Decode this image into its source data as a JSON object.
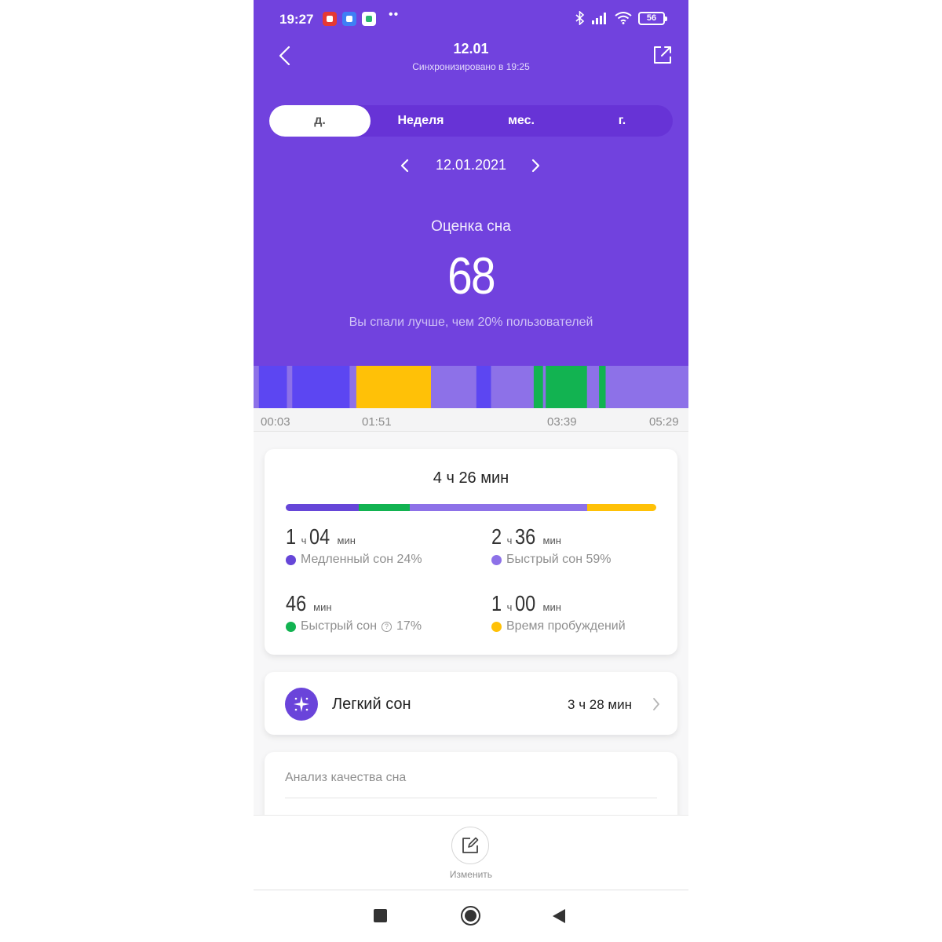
{
  "status_bar": {
    "time": "19:27",
    "notifications": [
      {
        "icon": "youtube-music-icon",
        "color": "#e53935"
      },
      {
        "icon": "message-icon",
        "color": "#3f7ff5"
      },
      {
        "icon": "mi-fit-icon",
        "color": "#ffffff"
      }
    ],
    "dots": "••",
    "battery": "56",
    "icons": [
      "bluetooth-icon",
      "signal-icon",
      "wifi-icon",
      "battery-icon"
    ]
  },
  "header": {
    "title": "12.01",
    "subtitle": "Синхронизировано в 19:25",
    "back_icon": "chevron-left-icon",
    "share_icon": "share-icon"
  },
  "tabs": [
    {
      "label": "д.",
      "active": true
    },
    {
      "label": "Неделя",
      "active": false
    },
    {
      "label": "мес.",
      "active": false
    },
    {
      "label": "г.",
      "active": false
    }
  ],
  "date_nav": {
    "date": "12.01.2021"
  },
  "score": {
    "label": "Оценка сна",
    "value": "68",
    "comparison": "Вы спали лучше, чем 20% пользователей"
  },
  "timeline": {
    "ticks": [
      "00:03",
      "01:51",
      "03:39",
      "05:29"
    ],
    "colors": {
      "deep": "#5c46f2",
      "light": "#8d71e8",
      "rem": "#12b351",
      "awake": "#ffc107"
    },
    "segments": [
      {
        "stage": "light",
        "start": "00:03",
        "end": "00:07"
      },
      {
        "stage": "deep",
        "start": "00:07",
        "end": "00:28"
      },
      {
        "stage": "light",
        "start": "00:28",
        "end": "00:32"
      },
      {
        "stage": "deep",
        "start": "00:32",
        "end": "01:15"
      },
      {
        "stage": "light",
        "start": "01:15",
        "end": "01:20"
      },
      {
        "stage": "awake",
        "start": "01:20",
        "end": "02:16"
      },
      {
        "stage": "light",
        "start": "02:16",
        "end": "02:50"
      },
      {
        "stage": "deep",
        "start": "02:50",
        "end": "03:01"
      },
      {
        "stage": "light",
        "start": "03:01",
        "end": "03:33"
      },
      {
        "stage": "rem",
        "start": "03:33",
        "end": "03:40"
      },
      {
        "stage": "light",
        "start": "03:40",
        "end": "03:42"
      },
      {
        "stage": "rem",
        "start": "03:42",
        "end": "04:13"
      },
      {
        "stage": "light",
        "start": "04:13",
        "end": "04:22"
      },
      {
        "stage": "rem",
        "start": "04:22",
        "end": "04:27"
      },
      {
        "stage": "light",
        "start": "04:27",
        "end": "05:29"
      }
    ]
  },
  "summary": {
    "total": "4 ч 26 мин",
    "bar": [
      {
        "stage": "deep",
        "color": "#6646d8",
        "fraction": 0.196
      },
      {
        "stage": "rem",
        "color": "#12b351",
        "fraction": 0.139
      },
      {
        "stage": "light",
        "color": "#8d71e8",
        "fraction": 0.479
      },
      {
        "stage": "awake",
        "color": "#ffc107",
        "fraction": 0.186
      }
    ],
    "stats": [
      {
        "parts": [
          "1",
          "ч",
          "04",
          "мин"
        ],
        "label": "Медленный сон 24%",
        "color": "#6646d8"
      },
      {
        "parts": [
          "2",
          "ч",
          "36",
          "мин"
        ],
        "label": "Быстрый сон 59%",
        "color": "#8d71e8"
      },
      {
        "parts": [
          "46",
          "мин"
        ],
        "label": "Быстрый сон",
        "label_suffix": "17%",
        "help": "?",
        "color": "#12b351"
      },
      {
        "parts": [
          "1",
          "ч",
          "00",
          "мин"
        ],
        "label": "Время пробуждений",
        "color": "#ffc107"
      }
    ]
  },
  "light_sleep": {
    "label": "Легкий сон",
    "value": "3 ч 28 мин",
    "icon": "sparkle-icon"
  },
  "analysis": {
    "label": "Анализ качества сна"
  },
  "edit": {
    "label": "Изменить",
    "icon": "edit-icon"
  },
  "system_nav": [
    "recents-icon",
    "home-icon",
    "back-icon"
  ]
}
